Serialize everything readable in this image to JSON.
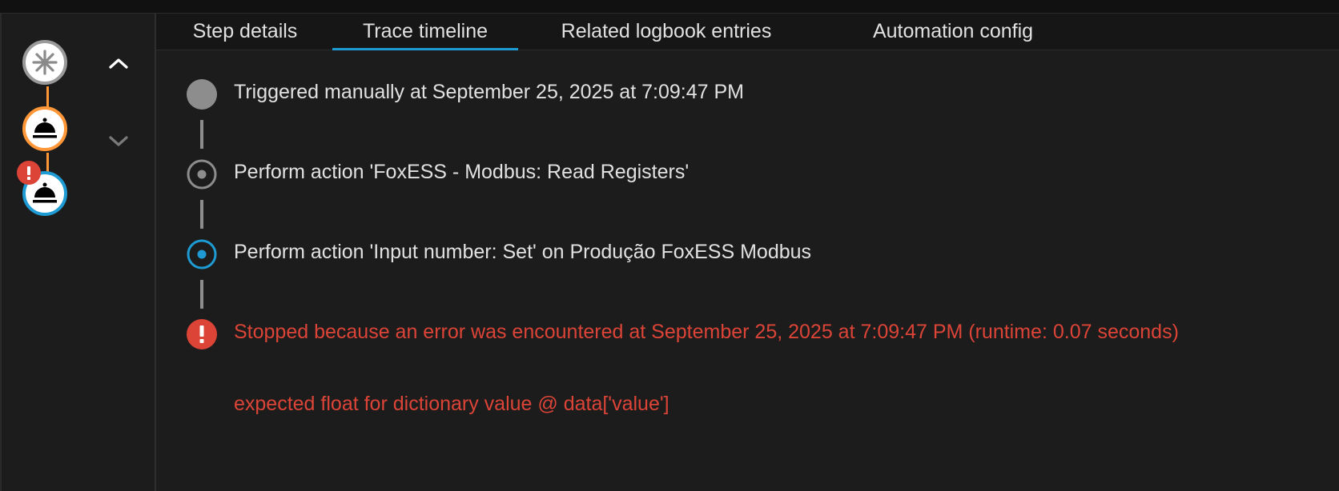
{
  "tabs": [
    {
      "label": "Step details"
    },
    {
      "label": "Trace timeline"
    },
    {
      "label": "Related logbook entries"
    },
    {
      "label": "Automation config"
    }
  ],
  "active_tab": "Trace timeline",
  "graph": {
    "nodes": [
      {
        "kind": "trigger",
        "icon": "asterisk-icon",
        "color": "#9a9a9a"
      },
      {
        "kind": "action",
        "icon": "bell-service-icon",
        "color": "#ff9738"
      },
      {
        "kind": "action",
        "icon": "bell-service-icon",
        "color": "#1e9bd2"
      }
    ],
    "error_badge": "!"
  },
  "timeline": [
    {
      "text": "Triggered manually at September 25, 2025 at 7:09:47 PM"
    },
    {
      "text": "Perform action 'FoxESS - Modbus: Read Registers'"
    },
    {
      "text": "Perform action 'Input number: Set' on Produção FoxESS Modbus"
    },
    {
      "text": "Stopped because an error was encountered at September 25, 2025 at 7:09:47 PM (runtime: 0.07 seconds)"
    },
    {
      "text": "expected float for dictionary value @ data['value']"
    }
  ],
  "colors": {
    "accent": "#1e9bd2",
    "error": "#db4437",
    "warning": "#ff9738",
    "muted": "#8d8d8d"
  }
}
